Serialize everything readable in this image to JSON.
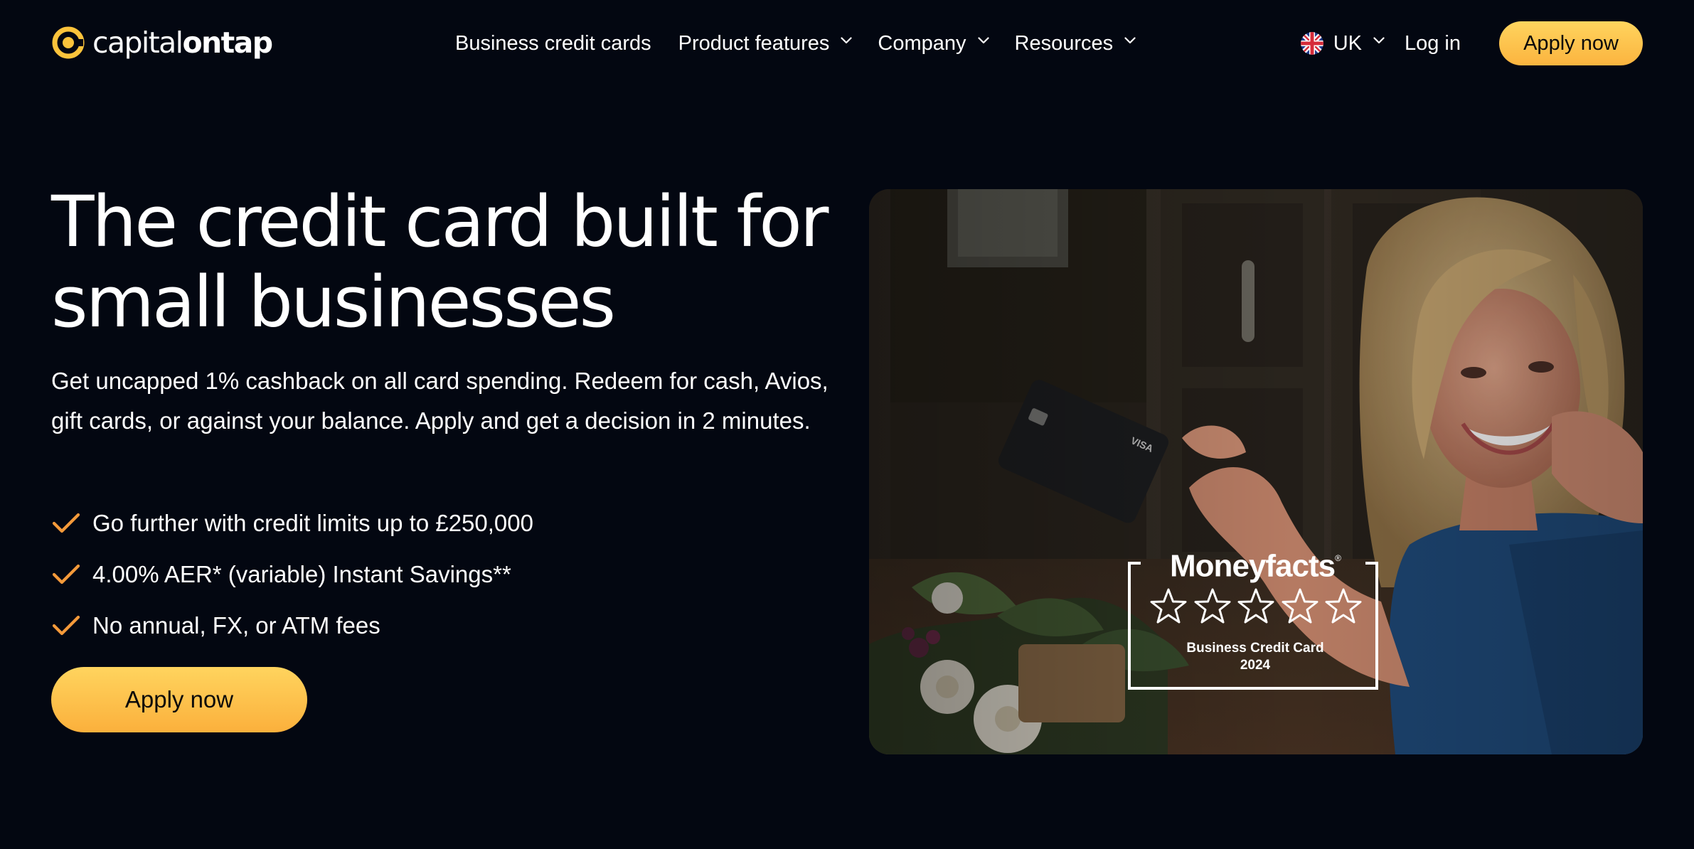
{
  "brand": {
    "name_light": "capital",
    "name_bold": "ontap",
    "logo_color": "#fcc33b"
  },
  "nav": {
    "links": [
      {
        "label": "Business credit cards",
        "has_dropdown": false
      },
      {
        "label": "Product features",
        "has_dropdown": true
      },
      {
        "label": "Company",
        "has_dropdown": true
      },
      {
        "label": "Resources",
        "has_dropdown": true
      }
    ],
    "locale": {
      "label": "UK",
      "icon": "uk-flag-icon"
    },
    "login_label": "Log in",
    "apply_label": "Apply now"
  },
  "hero": {
    "title_line1": "The credit card built for",
    "title_line2": "small businesses",
    "subtitle": "Get uncapped 1% cashback on all card spending. Redeem for cash, Avios, gift cards, or against your balance. Apply and get a decision in 2 minutes.",
    "features": [
      "Go further with credit limits up to £250,000",
      "4.00% AER* (variable) Instant Savings**",
      "No annual, FX, or ATM fees"
    ],
    "cta_label": "Apply now"
  },
  "award": {
    "brand": "Moneyfacts",
    "trademark": "®",
    "stars": 5,
    "category": "Business Credit Card",
    "year": "2024"
  },
  "colors": {
    "background": "#030711",
    "accent_yellow": "#fbb43f",
    "check_orange": "#f59a3a",
    "text": "#ffffff"
  }
}
